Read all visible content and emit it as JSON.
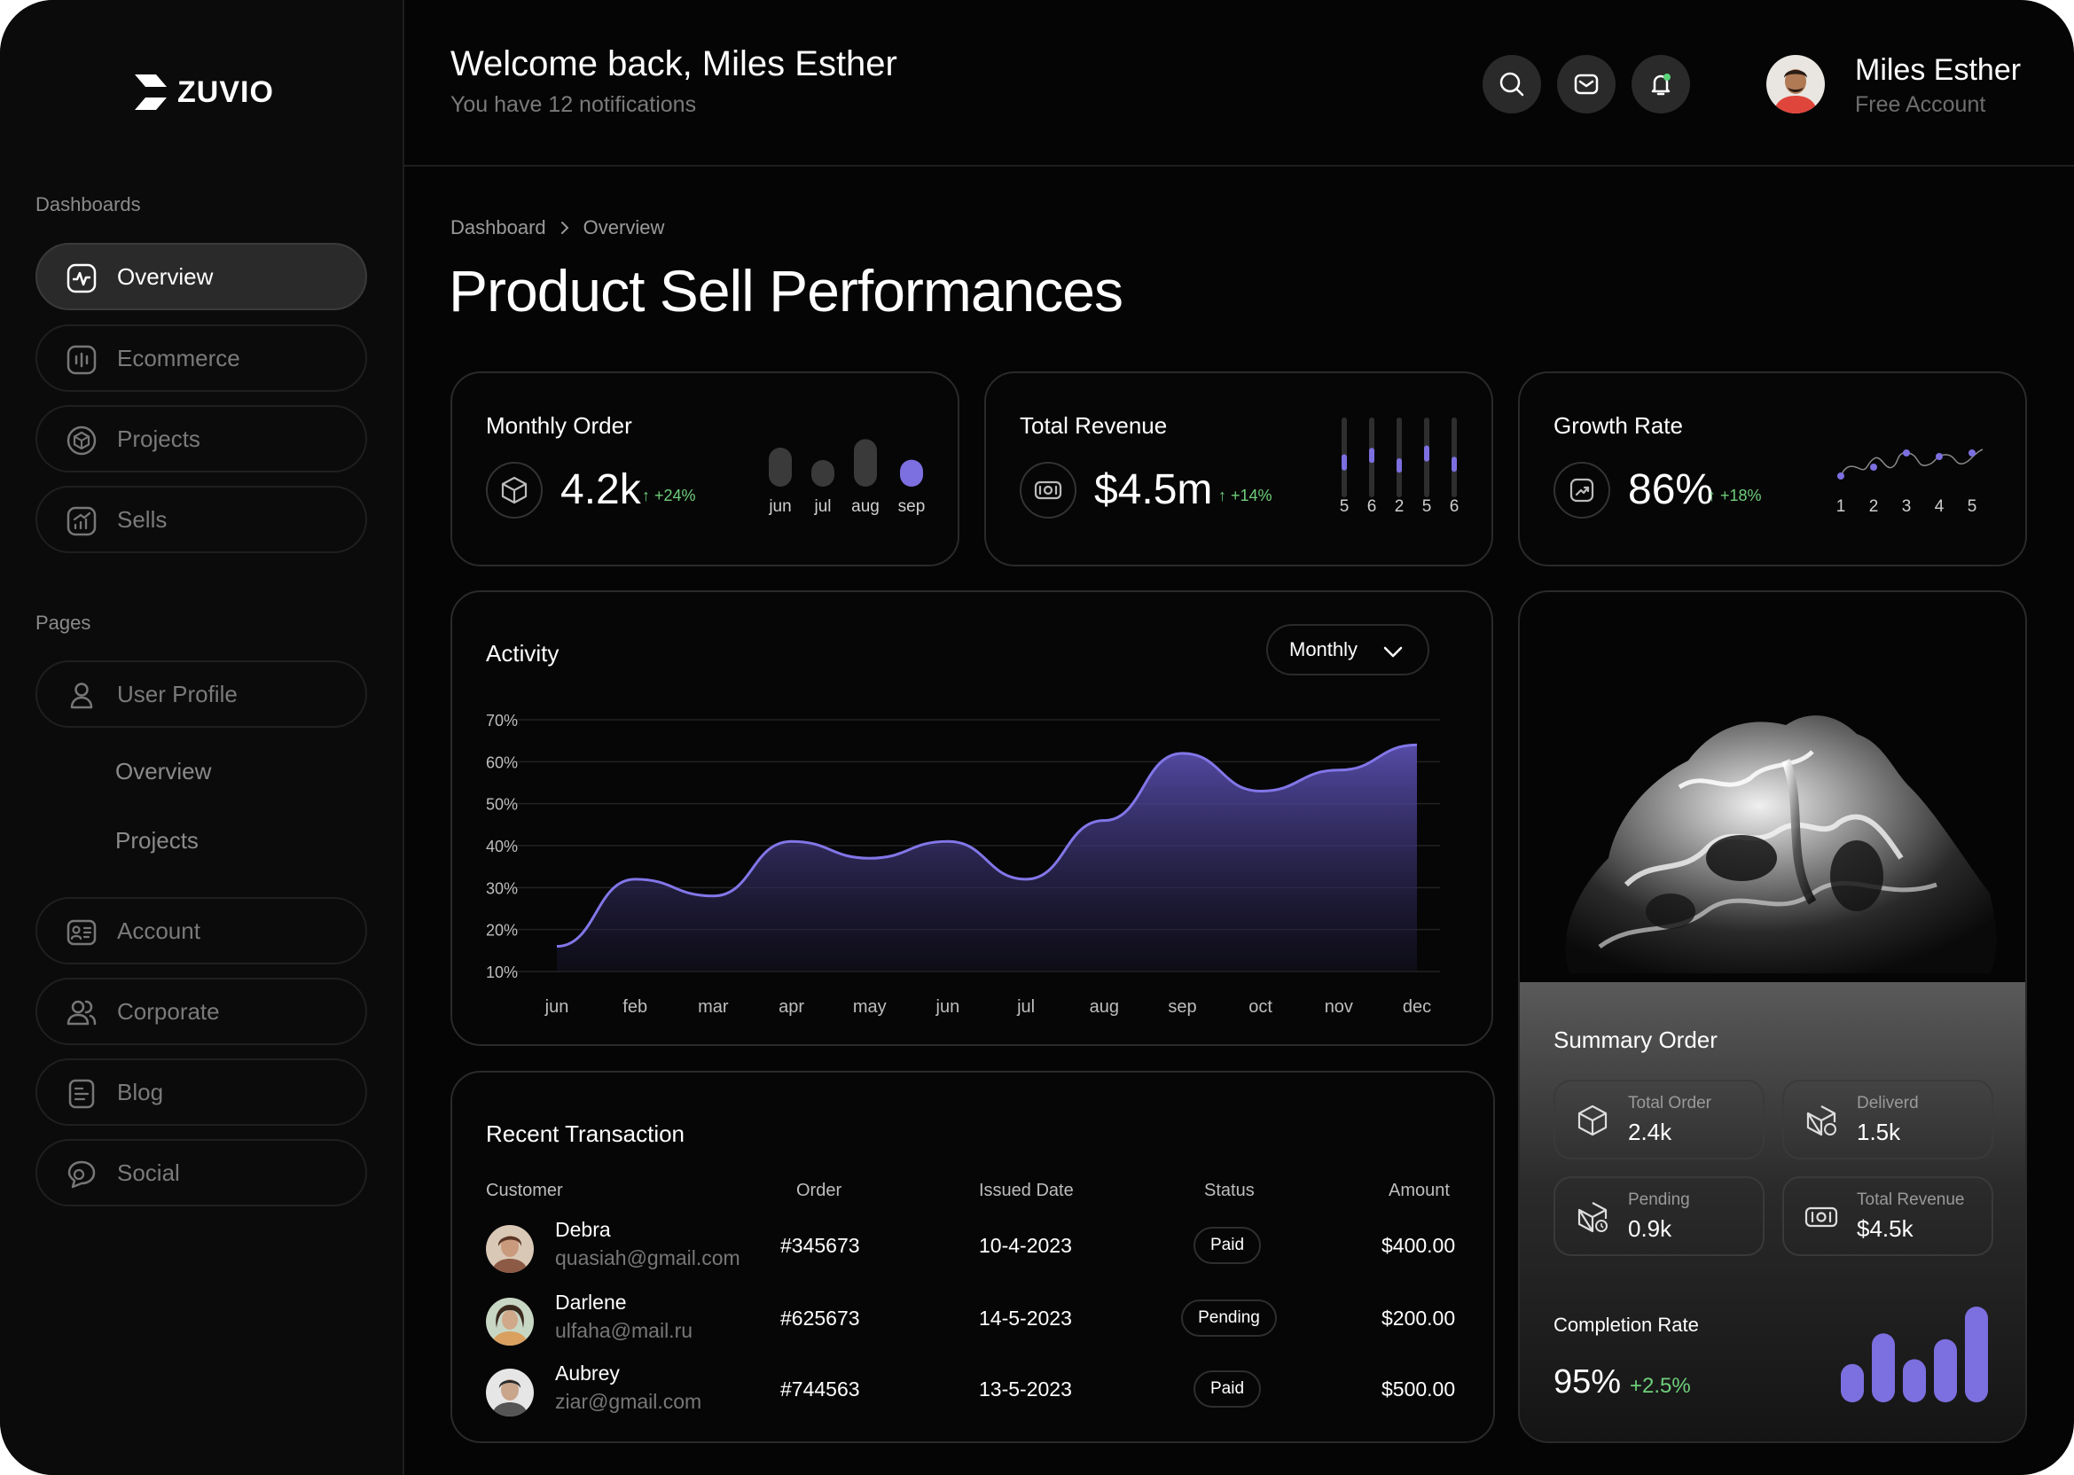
{
  "brand": {
    "name": "ZUVIO"
  },
  "sidebar": {
    "dashboards_label": "Dashboards",
    "dashboards": [
      {
        "label": "Overview",
        "icon": "activity-icon"
      },
      {
        "label": "Ecommerce",
        "icon": "bars-icon"
      },
      {
        "label": "Projects",
        "icon": "hexagon-icon"
      },
      {
        "label": "Sells",
        "icon": "chart-up-icon"
      }
    ],
    "pages_label": "Pages",
    "user_profile": {
      "label": "User Profile",
      "icon": "user-icon"
    },
    "sub_items": [
      "Overview",
      "Projects"
    ],
    "pages": [
      {
        "label": "Account",
        "icon": "id-card-icon"
      },
      {
        "label": "Corporate",
        "icon": "users-icon"
      },
      {
        "label": "Blog",
        "icon": "document-icon"
      },
      {
        "label": "Social",
        "icon": "chat-icon"
      }
    ]
  },
  "header": {
    "welcome": "Welcome back, Miles Esther",
    "notifications": "You have 12 notifications",
    "user_name": "Miles Esther",
    "user_plan": "Free Account"
  },
  "breadcrumb": {
    "root": "Dashboard",
    "current": "Overview"
  },
  "page_title": "Product Sell Performances",
  "stats": {
    "monthly_order": {
      "label": "Monthly Order",
      "value": "4.2k",
      "delta": "+24%",
      "months": [
        "jun",
        "jul",
        "aug",
        "sep"
      ],
      "levels": [
        0.55,
        0.27,
        0.67,
        0.38
      ]
    },
    "total_revenue": {
      "label": "Total Revenue",
      "value": "$4.5m",
      "delta": "+14%",
      "ticks": [
        "5",
        "6",
        "2",
        "5",
        "6"
      ],
      "levels": [
        0.45,
        0.42,
        0.4,
        0.45,
        0.42
      ]
    },
    "growth_rate": {
      "label": "Growth Rate",
      "value": "86%",
      "delta": "+18%",
      "ticks": [
        "1",
        "2",
        "3",
        "4",
        "5"
      ]
    }
  },
  "activity": {
    "title": "Activity",
    "period": "Monthly"
  },
  "chart_data": {
    "type": "area",
    "title": "Activity",
    "categories": [
      "jun",
      "feb",
      "mar",
      "apr",
      "may",
      "jun",
      "jul",
      "aug",
      "sep",
      "oct",
      "nov",
      "dec"
    ],
    "values": [
      16,
      32,
      28,
      41,
      37,
      41,
      32,
      46,
      62,
      53,
      58,
      64
    ],
    "y_ticks": [
      "70%",
      "60%",
      "50%",
      "40%",
      "30%",
      "20%",
      "10%"
    ],
    "ylim": [
      10,
      70
    ],
    "grid": true,
    "color": "#7c6fe0"
  },
  "transactions": {
    "title": "Recent Transaction",
    "columns": [
      "Customer",
      "Order",
      "Issued Date",
      "Status",
      "Amount"
    ],
    "rows": [
      {
        "name": "Debra",
        "email": "quasiah@gmail.com",
        "order": "#345673",
        "date": "10-4-2023",
        "status": "Paid",
        "amount": "$400.00"
      },
      {
        "name": "Darlene",
        "email": "ulfaha@mail.ru",
        "order": "#625673",
        "date": "14-5-2023",
        "status": "Pending",
        "amount": "$200.00"
      },
      {
        "name": "Aubrey",
        "email": "ziar@gmail.com",
        "order": "#744563",
        "date": "13-5-2023",
        "status": "Paid",
        "amount": "$500.00"
      }
    ]
  },
  "summary": {
    "title": "Summary Order",
    "items": [
      {
        "label": "Total Order",
        "value": "2.4k",
        "icon": "box-icon"
      },
      {
        "label": "Deliverd",
        "value": "1.5k",
        "icon": "box-check-icon"
      },
      {
        "label": "Pending",
        "value": "0.9k",
        "icon": "box-clock-icon"
      },
      {
        "label": "Total Revenue",
        "value": "$4.5k",
        "icon": "cash-icon"
      }
    ],
    "completion_label": "Completion Rate",
    "completion_value": "95%",
    "completion_delta": "+2.5%",
    "completion_levels": [
      0.4,
      0.72,
      0.45,
      0.66,
      1.0
    ]
  },
  "colors": {
    "accent": "#7c6fe0",
    "positive": "#6fcf7b",
    "background": "#050505"
  }
}
